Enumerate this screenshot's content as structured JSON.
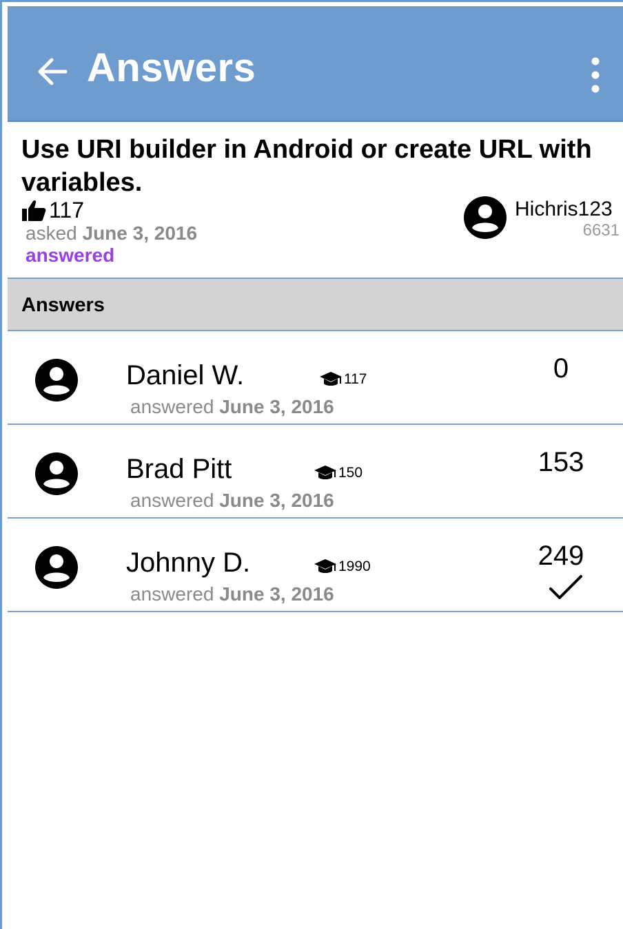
{
  "appbar": {
    "title": "Answers",
    "back_icon": "arrow-left-icon",
    "menu_icon": "more-vertical-icon",
    "bg_color": "#6e9ccf"
  },
  "question": {
    "title": "Use URI builder in Android or create URL with variables.",
    "votes": "117",
    "asked_label": "asked",
    "asked_date": "June 3, 2016",
    "status": "answered",
    "status_color": "#9a3ee6",
    "author": {
      "name": "Hichris123",
      "reputation": "6631"
    }
  },
  "answers_section": {
    "title": "Answers"
  },
  "answers": [
    {
      "name": "Daniel W.",
      "reputation": "117",
      "date_label": "answered",
      "date": "June 3, 2016",
      "score": "0",
      "accepted": false
    },
    {
      "name": "Brad Pitt",
      "reputation": "150",
      "date_label": "answered",
      "date": "June 3, 2016",
      "score": "153",
      "accepted": false
    },
    {
      "name": "Johnny D.",
      "reputation": "1990",
      "date_label": "answered",
      "date": "June 3, 2016",
      "score": "249",
      "accepted": true
    }
  ]
}
